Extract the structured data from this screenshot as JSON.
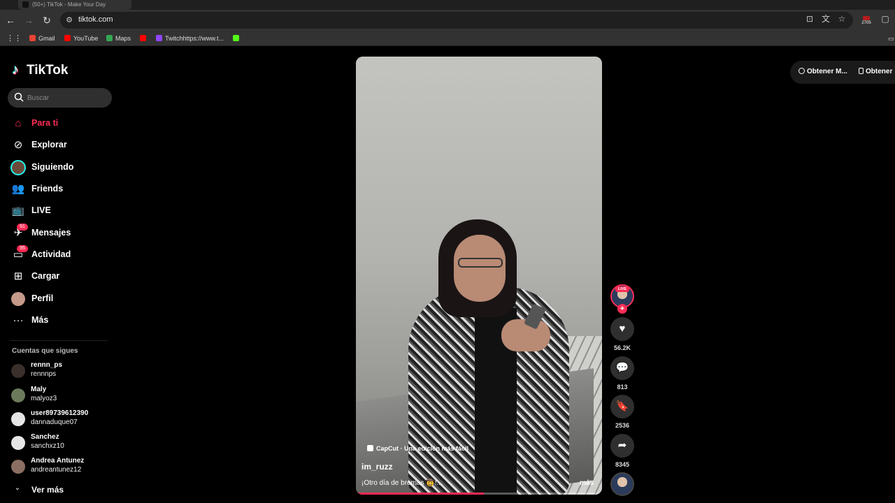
{
  "browser": {
    "tab_title": "(50+) TikTok - Make Your Day",
    "url": "tiktok.com",
    "extension_badge": "2705",
    "bookmarks": [
      {
        "label": "Gmail",
        "color": "#ea4335"
      },
      {
        "label": "YouTube",
        "color": "#ff0000"
      },
      {
        "label": "Maps",
        "color": "#34a853"
      },
      {
        "label": "",
        "color": "#ff0000"
      },
      {
        "label": "Twitchhttps://www.t...",
        "color": "#9146ff"
      },
      {
        "label": "",
        "color": "#53fc18"
      }
    ]
  },
  "sidebar": {
    "logo_text": "TikTok",
    "search_placeholder": "Buscar",
    "menu": [
      {
        "label": "Para ti",
        "icon": "home-icon",
        "active": true
      },
      {
        "label": "Explorar",
        "icon": "compass-icon"
      },
      {
        "label": "Siguiendo",
        "icon": "following-avatar-icon"
      },
      {
        "label": "Friends",
        "icon": "friends-icon"
      },
      {
        "label": "LIVE",
        "icon": "live-tv-icon"
      },
      {
        "label": "Mensajes",
        "icon": "paper-plane-icon",
        "badge": "91"
      },
      {
        "label": "Actividad",
        "icon": "activity-icon",
        "badge": "95"
      },
      {
        "label": "Cargar",
        "icon": "upload-plus-icon"
      },
      {
        "label": "Perfil",
        "icon": "profile-avatar-icon"
      },
      {
        "label": "Más",
        "icon": "more-dots-icon"
      }
    ],
    "following_title": "Cuentas que sigues",
    "following": [
      {
        "name": "rennn_ps",
        "handle": "rennnps"
      },
      {
        "name": "Maly",
        "handle": "malyoz3"
      },
      {
        "name": "user89739612390",
        "handle": "dannaduque07"
      },
      {
        "name": "Sanchez",
        "handle": "sanchxz10"
      },
      {
        "name": "Andrea Antunez",
        "handle": "andreantunez12"
      }
    ],
    "see_more": "Ver más"
  },
  "video": {
    "capcut_label": "CapCut · Una edición más fácil",
    "username": "im_ruzz",
    "caption": "¡Otro día de bromas 🤠!...",
    "more_label": "más",
    "progress": 0.52
  },
  "actions": {
    "live_tag": "LIVE",
    "likes": "56.2K",
    "comments": "813",
    "saves": "2536",
    "shares": "8345"
  },
  "top_right": {
    "get_app_1": "Obtener M...",
    "get_app_2": "Obtener"
  },
  "colors": {
    "accent": "#fe2c55",
    "background": "#000000"
  }
}
